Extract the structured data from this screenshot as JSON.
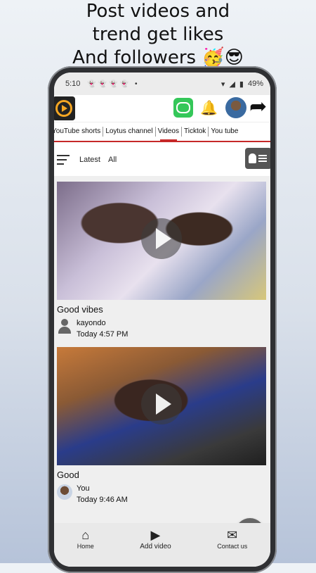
{
  "promo": {
    "line1": "Post videos and",
    "line2": "trend get likes",
    "line3": "And followers 🥳😎"
  },
  "statusbar": {
    "time": "5:10",
    "battery": "49%"
  },
  "tabs": [
    {
      "label": "YouTube shorts"
    },
    {
      "label": "Loytus channel"
    },
    {
      "label": "Videos"
    },
    {
      "label": "Ticktok"
    },
    {
      "label": "You tube"
    }
  ],
  "filter": {
    "latest": "Latest",
    "all": "All"
  },
  "posts": [
    {
      "title": "Good vibes",
      "author": "kayondo",
      "time": "Today 4:57 PM"
    },
    {
      "title": "Good",
      "author": "You",
      "time": "Today 9:46 AM"
    }
  ],
  "fab_label": "+",
  "bottom_nav": {
    "home": "Home",
    "add_video": "Add video",
    "contact": "Contact us"
  },
  "colors": {
    "accent": "#c62828",
    "chat_green": "#34c759",
    "bell_red": "#e53935",
    "logo_orange": "#f5a623"
  }
}
